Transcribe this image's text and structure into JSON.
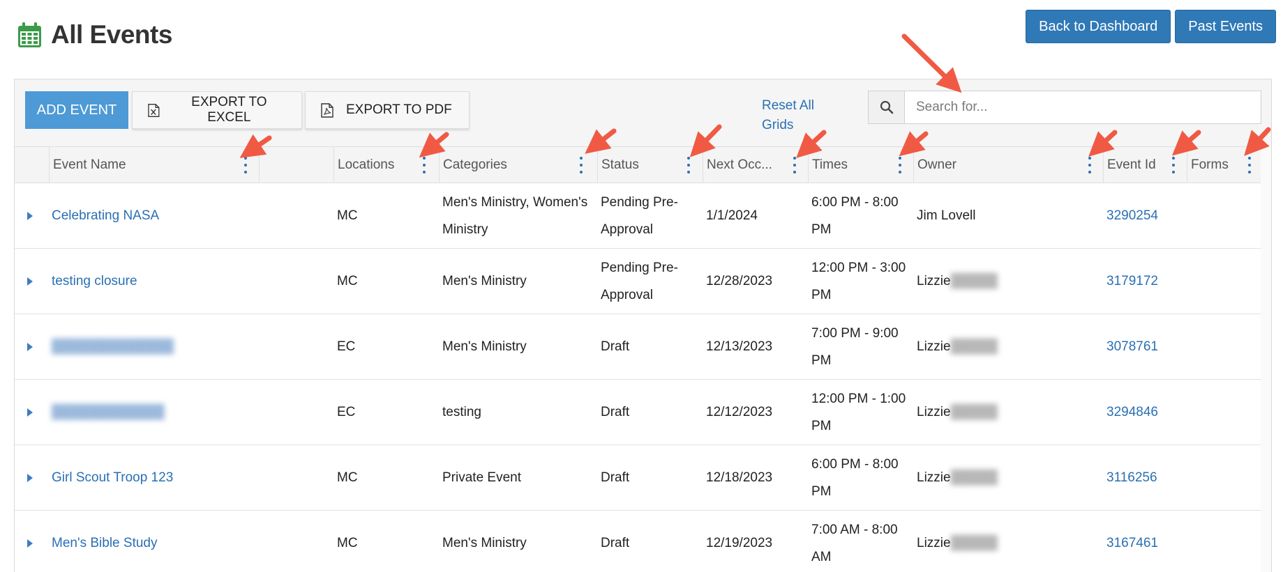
{
  "header": {
    "title": "All Events",
    "buttons": [
      {
        "label": "Back to Dashboard"
      },
      {
        "label": "Past Events"
      }
    ]
  },
  "toolbar": {
    "add_event": "ADD EVENT",
    "export_excel": "EXPORT TO EXCEL",
    "export_pdf": "EXPORT TO PDF",
    "reset_grids": "Reset All Grids",
    "search_placeholder": "Search for..."
  },
  "columns": [
    {
      "key": "name",
      "label": "Event Name"
    },
    {
      "key": "locations",
      "label": "Locations"
    },
    {
      "key": "categories",
      "label": "Categories"
    },
    {
      "key": "status",
      "label": "Status"
    },
    {
      "key": "next",
      "label": "Next Occ..."
    },
    {
      "key": "times",
      "label": "Times"
    },
    {
      "key": "owner",
      "label": "Owner"
    },
    {
      "key": "id",
      "label": "Event Id"
    },
    {
      "key": "forms",
      "label": "Forms"
    }
  ],
  "rows": [
    {
      "name": "Celebrating NASA",
      "locations": "MC",
      "categories": "Men's Ministry, Women's Ministry",
      "status": "Pending Pre-Approval",
      "next": "1/1/2024",
      "times": "6:00 PM - 8:00 PM",
      "owner": "Jim Lovell",
      "id": "3290254",
      "forms": ""
    },
    {
      "name": "testing closure",
      "locations": "MC",
      "categories": "Men's Ministry",
      "status": "Pending Pre-Approval",
      "next": "12/28/2023",
      "times": "12:00 PM - 3:00 PM",
      "owner": "Lizzie",
      "id": "3179172",
      "forms": ""
    },
    {
      "name": "",
      "locations": "EC",
      "categories": "Men's Ministry",
      "status": "Draft",
      "next": "12/13/2023",
      "times": "7:00 PM - 9:00 PM",
      "owner": "Lizzie",
      "id": "3078761",
      "forms": ""
    },
    {
      "name": "",
      "locations": "EC",
      "categories": "testing",
      "status": "Draft",
      "next": "12/12/2023",
      "times": "12:00 PM - 1:00 PM",
      "owner": "Lizzie",
      "id": "3294846",
      "forms": ""
    },
    {
      "name": "Girl Scout Troop 123",
      "locations": "MC",
      "categories": "Private Event",
      "status": "Draft",
      "next": "12/18/2023",
      "times": "6:00 PM - 8:00 PM",
      "owner": "Lizzie",
      "id": "3116256",
      "forms": ""
    },
    {
      "name": "Men's Bible Study",
      "locations": "MC",
      "categories": "Men's Ministry",
      "status": "Draft",
      "next": "12/19/2023",
      "times": "7:00 AM - 8:00 AM",
      "owner": "Lizzie",
      "id": "3167461",
      "forms": ""
    }
  ],
  "colors": {
    "primary": "#2f79b7",
    "add_button": "#4d9ad6",
    "link": "#2a6fb3",
    "icon_green": "#3c9b48",
    "annotation_arrow": "#f05a44"
  }
}
